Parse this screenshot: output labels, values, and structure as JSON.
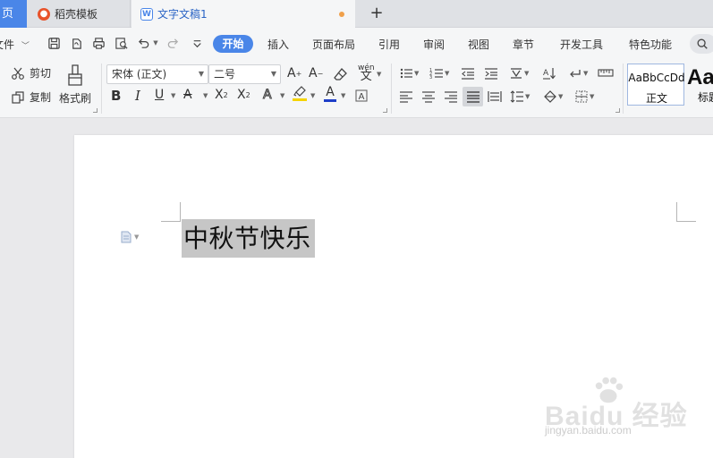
{
  "tabs": {
    "home_fragment": "页",
    "docer_label": "稻壳模板",
    "doc_label": "文字文稿1"
  },
  "menu": {
    "file_label": "文件",
    "items": [
      "开始",
      "插入",
      "页面布局",
      "引用",
      "审阅",
      "视图",
      "章节",
      "开发工具",
      "特色功能"
    ],
    "active": "开始"
  },
  "ribbon": {
    "cut": "剪切",
    "copy": "复制",
    "format_painter": "格式刷",
    "font_name": "宋体 (正文)",
    "font_size": "二号",
    "phonetic_label": "wén",
    "style_sample": "AaBbCcDd",
    "style_normal": "正文",
    "style_heading_sample": "Aa",
    "style_heading": "标题"
  },
  "document": {
    "text": "中秋节快乐"
  },
  "watermark": {
    "logo_text": "Baidu 经验",
    "url": "jingyan.baidu.com"
  },
  "colors": {
    "accent": "#4a86e8",
    "highlight_bar": "#f5d400",
    "font_color_bar": "#e03030",
    "selection": "#c6c6c6"
  }
}
